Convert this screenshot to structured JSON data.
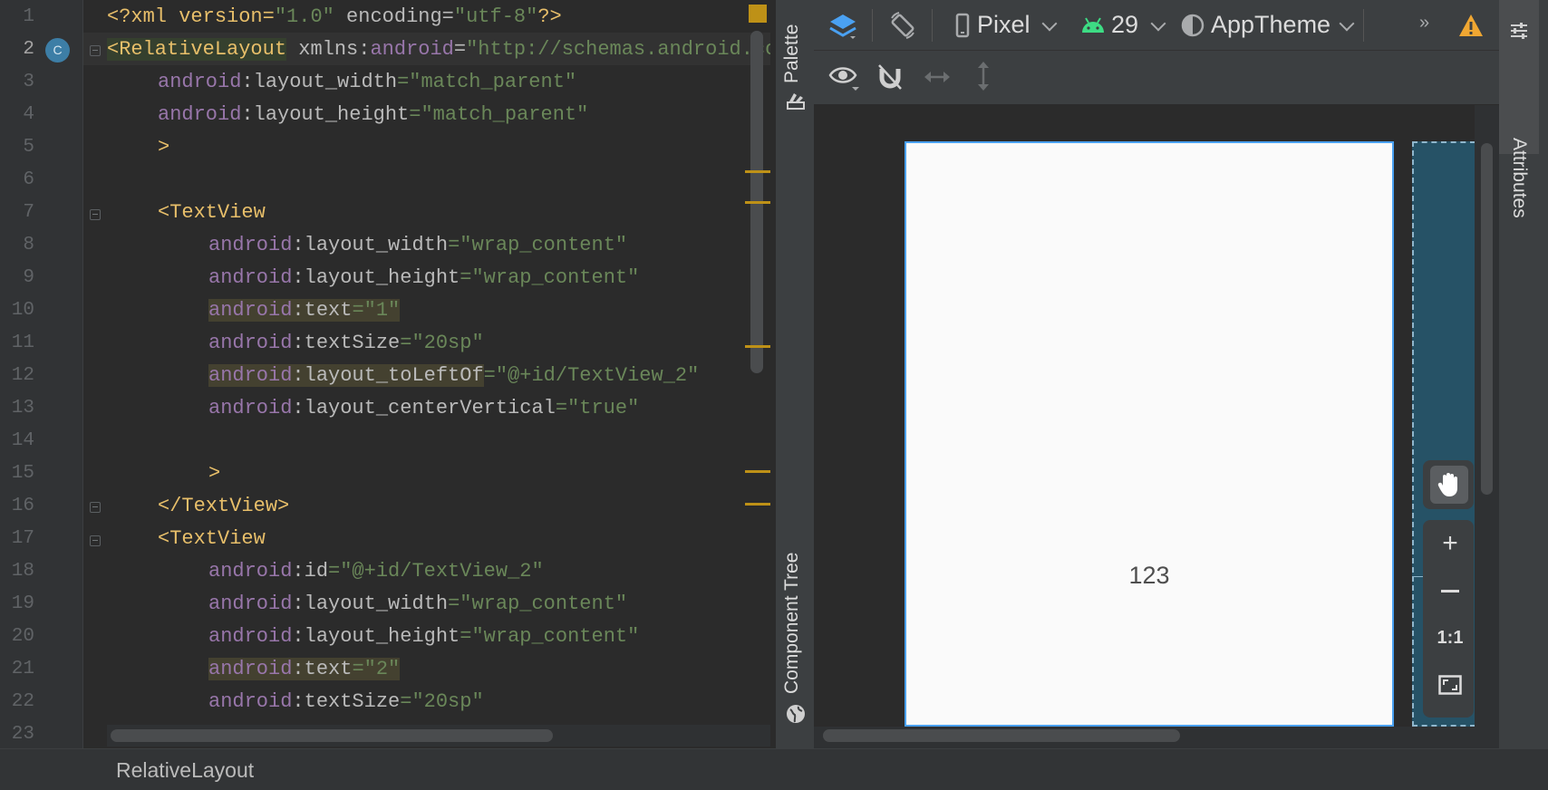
{
  "editor": {
    "current_line": 2,
    "lines": [
      {
        "n": "1"
      },
      {
        "n": "2"
      },
      {
        "n": "3"
      },
      {
        "n": "4"
      },
      {
        "n": "5"
      },
      {
        "n": "6"
      },
      {
        "n": "7"
      },
      {
        "n": "8"
      },
      {
        "n": "9"
      },
      {
        "n": "10"
      },
      {
        "n": "11"
      },
      {
        "n": "12"
      },
      {
        "n": "13"
      },
      {
        "n": "14"
      },
      {
        "n": "15"
      },
      {
        "n": "16"
      },
      {
        "n": "17"
      },
      {
        "n": "18"
      },
      {
        "n": "19"
      },
      {
        "n": "20"
      },
      {
        "n": "21"
      },
      {
        "n": "22"
      },
      {
        "n": "23"
      }
    ],
    "gutter_badge": "C",
    "code": {
      "l1_a": "<?xml version=",
      "l1_v1": "\"1.0\"",
      "l1_b": " encoding=",
      "l1_v2": "\"utf-8\"",
      "l1_c": "?>",
      "l2_tag": "<RelativeLayout",
      "l2_b": " xmlns:",
      "l2_ns": "android",
      "l2_c": "=",
      "l2_v": "\"http://schemas.android.com/apk/res/android\"",
      "l3_ns": "android",
      "l3_attr": ":layout_width",
      "l3_eq": "=",
      "l3_v": "\"match_parent\"",
      "l4_ns": "android",
      "l4_attr": ":layout_height",
      "l4_eq": "=",
      "l4_v": "\"match_parent\"",
      "l5": ">",
      "l7": "<TextView",
      "l8_ns": "android",
      "l8_attr": ":layout_width",
      "l8_eq": "=",
      "l8_v": "\"wrap_content\"",
      "l9_ns": "android",
      "l9_attr": ":layout_height",
      "l9_eq": "=",
      "l9_v": "\"wrap_content\"",
      "l10_ns": "android",
      "l10_attr": ":text",
      "l10_eq": "=",
      "l10_v": "\"1\"",
      "l11_ns": "android",
      "l11_attr": ":textSize",
      "l11_eq": "=",
      "l11_v": "\"20sp\"",
      "l12_ns": "android",
      "l12_attr": ":layout_toLeftOf",
      "l12_eq": "=",
      "l12_v": "\"@+id/TextView_2\"",
      "l13_ns": "android",
      "l13_attr": ":layout_centerVertical",
      "l13_eq": "=",
      "l13_v": "\"true\"",
      "l15": ">",
      "l16": "</TextView>",
      "l17": "<TextView",
      "l18_ns": "android",
      "l18_attr": ":id",
      "l18_eq": "=",
      "l18_v": "\"@+id/TextView_2\"",
      "l19_ns": "android",
      "l19_attr": ":layout_width",
      "l19_eq": "=",
      "l19_v": "\"wrap_content\"",
      "l20_ns": "android",
      "l20_attr": ":layout_height",
      "l20_eq": "=",
      "l20_v": "\"wrap_content\"",
      "l21_ns": "android",
      "l21_attr": ":text",
      "l21_eq": "=",
      "l21_v": "\"2\"",
      "l22_ns": "android",
      "l22_attr": ":textSize",
      "l22_eq": "=",
      "l22_v": "\"20sp\""
    }
  },
  "breadcrumb": {
    "text": "RelativeLayout"
  },
  "side_tabs": {
    "palette": "Palette",
    "component_tree": "Component Tree",
    "attributes": "Attributes"
  },
  "toolbar": {
    "device": "Pixel",
    "api": "29",
    "theme": "AppTheme",
    "overflow_icon": "double-chevron-right-icon",
    "warning_icon": "warning-icon"
  },
  "design": {
    "preview_text": "123"
  },
  "zoom": {
    "one_to_one": "1:1"
  },
  "colors": {
    "accent": "#4aa1f2",
    "warning": "#f0a732",
    "android_green": "#3ddc84",
    "blueprint": "#265266"
  }
}
